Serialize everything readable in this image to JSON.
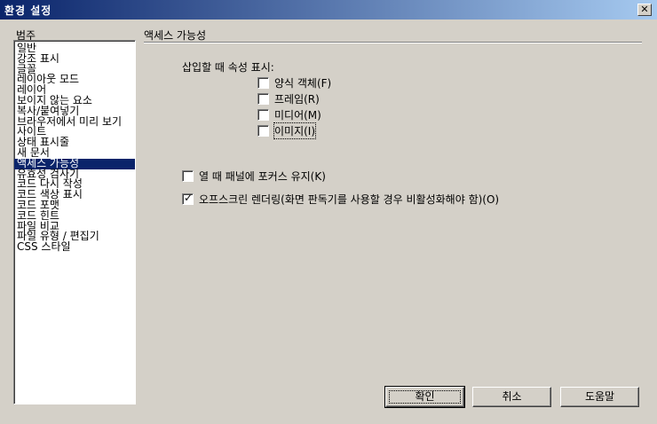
{
  "window": {
    "title": "환경 설정",
    "close_glyph": "✕"
  },
  "categories": {
    "header": "범주",
    "items": [
      {
        "label": "일반"
      },
      {
        "label": "강조 표시"
      },
      {
        "label": "글꼴"
      },
      {
        "label": "레이아웃 모드"
      },
      {
        "label": "레이어"
      },
      {
        "label": "보이지 않는 요소"
      },
      {
        "label": "복사/붙여넣기"
      },
      {
        "label": "브라우저에서 미리 보기"
      },
      {
        "label": "사이트"
      },
      {
        "label": "상태 표시줄"
      },
      {
        "label": "새 문서"
      },
      {
        "label": "액세스 가능성"
      },
      {
        "label": "유효성 검사기"
      },
      {
        "label": "코드 다시 작성"
      },
      {
        "label": "코드 색상 표시"
      },
      {
        "label": "코드 포맷"
      },
      {
        "label": "코드 힌트"
      },
      {
        "label": "파일 비교"
      },
      {
        "label": "파일 유형 / 편집기"
      },
      {
        "label": "CSS 스타일"
      }
    ],
    "selected": "액세스 가능성"
  },
  "panel": {
    "title": "액세스 가능성",
    "subheading": "삽입할 때 속성 표시:",
    "insert_options": [
      {
        "label": "양식 객체(F)",
        "checked": false
      },
      {
        "label": "프레임(R)",
        "checked": false
      },
      {
        "label": "미디어(M)",
        "checked": false
      },
      {
        "label": "이미지(I)",
        "checked": false
      }
    ],
    "focus_option": {
      "label": "열 때 패널에 포커스 유지(K)",
      "checked": false
    },
    "offscreen_option": {
      "label": "오프스크린 렌더링(화면 판독기를 사용할 경우 비활성화해야 함)(O)",
      "checked": true
    }
  },
  "buttons": {
    "ok": "확인",
    "cancel": "취소",
    "help": "도움말"
  }
}
